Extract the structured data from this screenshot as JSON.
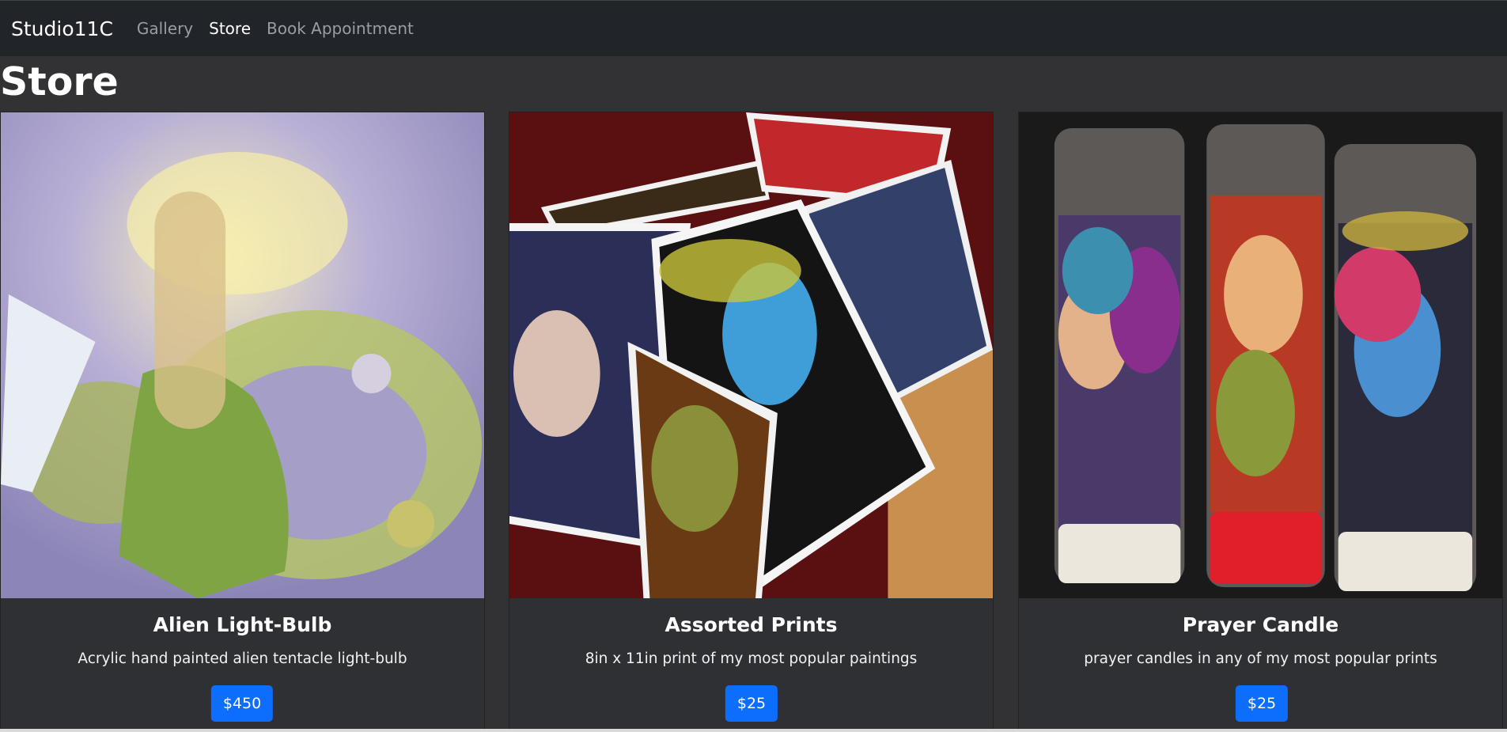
{
  "nav": {
    "brand": "Studio11C",
    "links": [
      "Gallery",
      "Store",
      "Book Appointment"
    ],
    "active": "Store"
  },
  "page": {
    "title": "Store"
  },
  "products": [
    {
      "title": "Alien Light-Bulb",
      "description": "Acrylic hand painted alien tentacle light-bulb",
      "price": "$450"
    },
    {
      "title": "Assorted Prints",
      "description": "8in x 11in print of my most popular paintings",
      "price": "$25"
    },
    {
      "title": "Prayer Candle",
      "description": "prayer candles in any of my most popular prints",
      "price": "$25"
    }
  ],
  "colors": {
    "navbar": "#212529",
    "background": "#323235",
    "button": "#0d6efd"
  }
}
